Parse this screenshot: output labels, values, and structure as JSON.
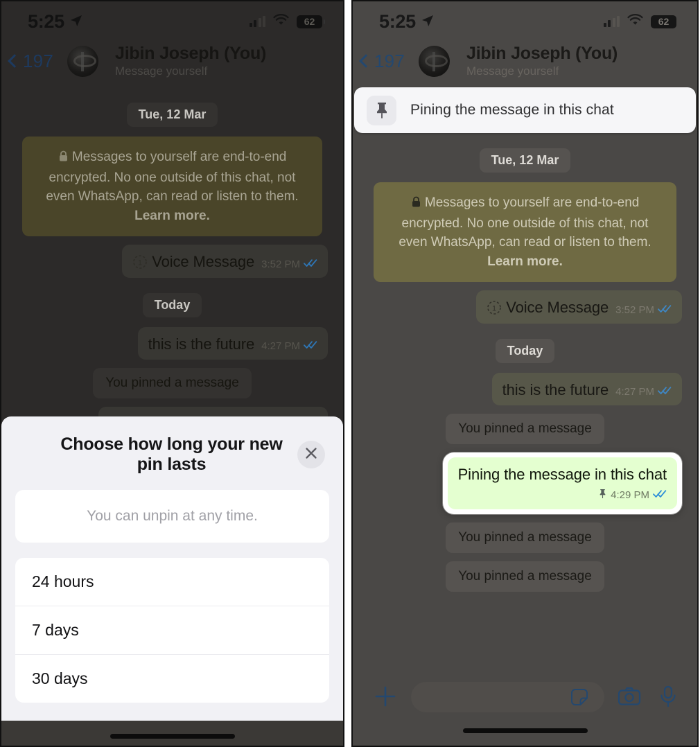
{
  "status_bar": {
    "time": "5:25",
    "battery_level": "62",
    "location_icon": "location-arrow-icon",
    "cellular_icon": "cellular-bars-icon",
    "wifi_icon": "wifi-icon"
  },
  "nav": {
    "back_icon": "chevron-left-icon",
    "back_count": "197",
    "contact_name": "Jibin Joseph (You)",
    "contact_subtitle": "Message yourself",
    "avatar_icon": "avatar"
  },
  "pinned_banner": {
    "icon": "pin-icon",
    "text": "Pining the message in this chat"
  },
  "chat": {
    "day_divider_1": "Tue, 12 Mar",
    "encryption_notice": {
      "lock_icon": "lock-icon",
      "text": "Messages to yourself are end-to-end encrypted. No one outside of this chat, not even WhatsApp, can read or listen to them.",
      "link": "Learn more."
    },
    "messages": [
      {
        "kind": "voice",
        "icon": "view-once-voice-icon",
        "text": "Voice Message",
        "time": "3:52 PM",
        "status_icon": "double-check-icon"
      },
      {
        "kind": "day",
        "text": "Today"
      },
      {
        "kind": "outgoing",
        "text": "this is the future",
        "time": "4:27 PM",
        "status_icon": "double-check-icon"
      },
      {
        "kind": "system",
        "text": "You pinned a message"
      },
      {
        "kind": "outgoing-pinned",
        "text": "Pining the message in this chat",
        "time": "4:29 PM",
        "pin_icon": "pin-icon",
        "status_icon": "double-check-icon"
      },
      {
        "kind": "system",
        "text": "You pinned a message"
      },
      {
        "kind": "system",
        "text": "You pinned a message"
      }
    ]
  },
  "input_bar": {
    "plus_icon": "plus-icon",
    "field_placeholder": "",
    "sticker_icon": "sticker-icon",
    "camera_icon": "camera-icon",
    "mic_icon": "microphone-icon"
  },
  "sheet": {
    "title": "Choose how long your new pin lasts",
    "close_icon": "close-icon",
    "note": "You can unpin at any time.",
    "options": [
      {
        "label": "24 hours"
      },
      {
        "label": "7 days"
      },
      {
        "label": "30 days"
      }
    ]
  },
  "colors": {
    "accent_blue": "#24486f",
    "pinned_bubble_green": "#e4ffd0",
    "encryption_olive": "#6f6a43",
    "sheet_background": "#f1f1f5",
    "dim_overlay_left": "#2c2a29",
    "chat_background": "#4a4846",
    "tick_blue": "#2e77b8"
  }
}
